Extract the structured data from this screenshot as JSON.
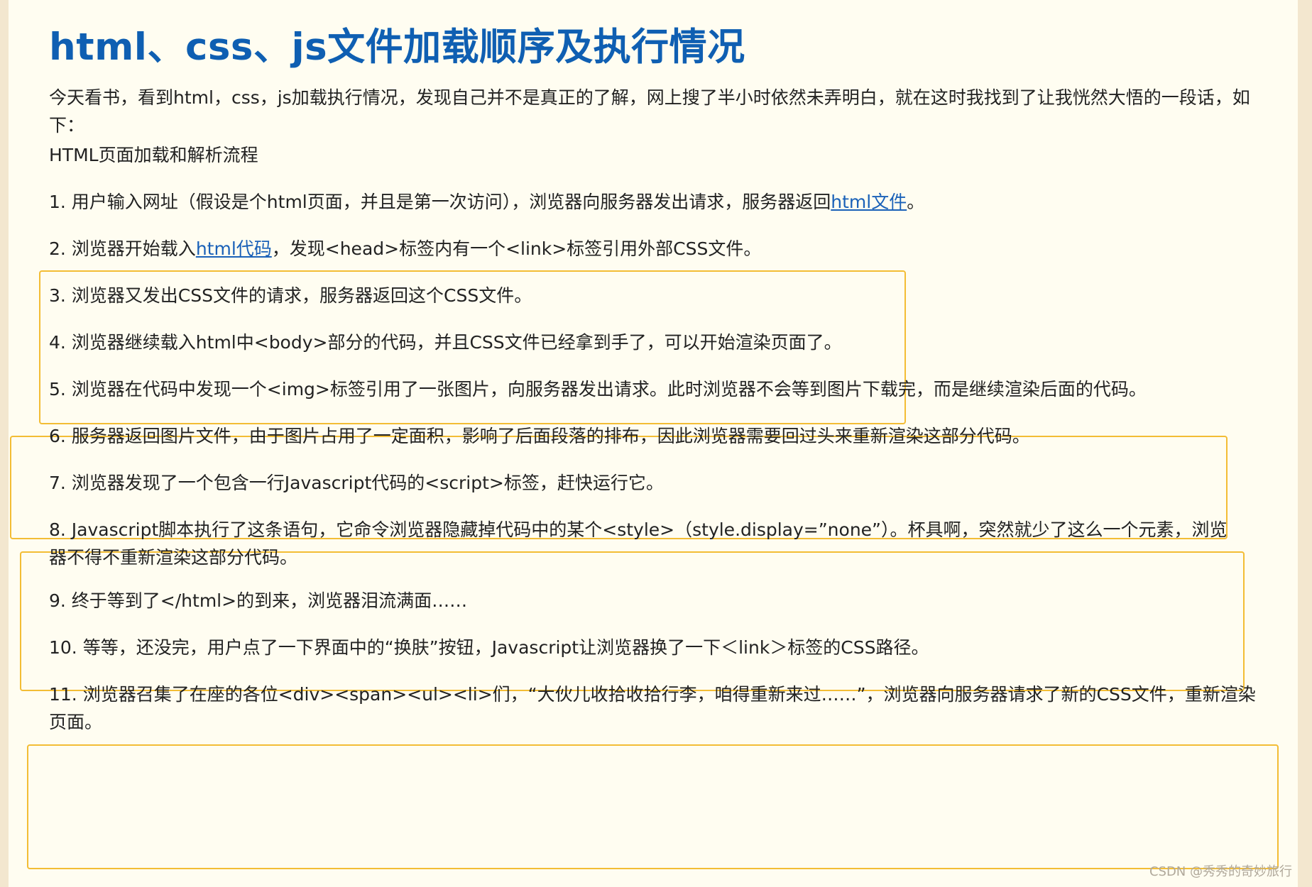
{
  "title": "html、css、js文件加载顺序及执行情况",
  "intro": "今天看书，看到html，css，js加载执行情况，发现自己并不是真正的了解，网上搜了半小时依然未弄明白，就在这时我找到了让我恍然大悟的一段话，如下：",
  "subtitle": "HTML页面加载和解析流程",
  "steps": {
    "s1": {
      "before": "1. 用户输入网址（假设是个html页面，并且是第一次访问），浏览器向服务器发出请求，服务器返回",
      "link": "html文件",
      "after": "。"
    },
    "s2": {
      "before": "2. 浏览器开始载入",
      "link": "html代码",
      "after": "，发现<head>标签内有一个<link>标签引用外部CSS文件。"
    },
    "s3": "3. 浏览器又发出CSS文件的请求，服务器返回这个CSS文件。",
    "s4": "4. 浏览器继续载入html中<body>部分的代码，并且CSS文件已经拿到手了，可以开始渲染页面了。",
    "s5": "5. 浏览器在代码中发现一个<img>标签引用了一张图片，向服务器发出请求。此时浏览器不会等到图片下载完，而是继续渲染后面的代码。",
    "s6": "6. 服务器返回图片文件，由于图片占用了一定面积，影响了后面段落的排布，因此浏览器需要回过头来重新渲染这部分代码。",
    "s7": "7. 浏览器发现了一个包含一行Javascript代码的<script>标签，赶快运行它。",
    "s8": "8. Javascript脚本执行了这条语句，它命令浏览器隐藏掉代码中的某个<style>（style.display=”none”）。杯具啊，突然就少了这么一个元素，浏览器不得不重新渲染这部分代码。",
    "s9": "9. 终于等到了</html>的到来，浏览器泪流满面……",
    "s10": "10. 等等，还没完，用户点了一下界面中的“换肤”按钮，Javascript让浏览器换了一下＜link＞标签的CSS路径。",
    "s11": "11. 浏览器召集了在座的各位<div><span><ul><li>们，“大伙儿收拾收拾行李，咱得重新来过……”，浏览器向服务器请求了新的CSS文件，重新渲染页面。"
  },
  "watermark": "CSDN @秀秀的奇妙旅行",
  "colors": {
    "title": "#0f5fb2",
    "link": "#1a61b8",
    "highlight_box": "#f3bd35",
    "page_background": "#fffdf1",
    "outer_background": "#f3e7cf"
  }
}
